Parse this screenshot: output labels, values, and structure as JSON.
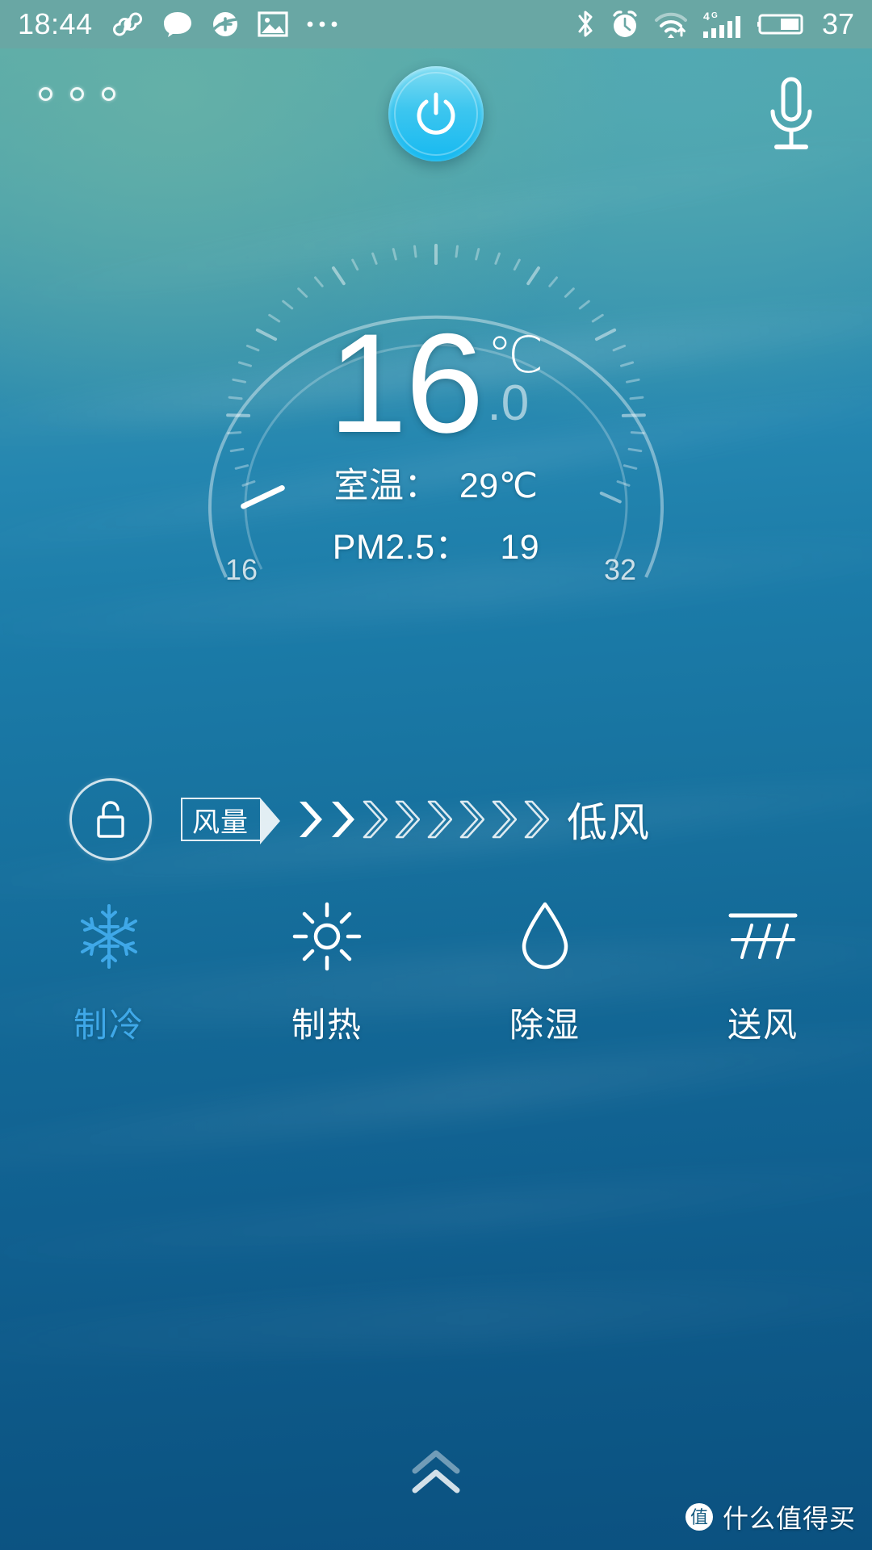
{
  "status_bar": {
    "time": "18:44",
    "battery_percent": "37",
    "network_type": "4G",
    "left_icons": [
      "infinity-icon",
      "chat-bubble-icon",
      "health-plus-icon",
      "gallery-icon",
      "more-dots-icon"
    ],
    "right_icons": [
      "bluetooth-icon",
      "alarm-clock-icon",
      "wifi-icon",
      "signal-bars-icon",
      "battery-icon"
    ],
    "background_color": "#69a7a4"
  },
  "top_bar": {
    "menu_dots_count": 3,
    "power_label": "power-toggle",
    "power_color": "#16b9f0",
    "mic_label": "voice-input"
  },
  "dial": {
    "set_temperature": "16",
    "temperature_decimal": ".0",
    "unit": "℃",
    "range_min": "16",
    "range_max": "32",
    "room_temp_line": "室温：  29℃",
    "pm25_line": "PM2.5：   19",
    "room_temp_label": "室温",
    "room_temp_value": "29℃",
    "pm25_label": "PM2.5",
    "pm25_value": "19",
    "tick_count": 41,
    "handle_position_value": "16"
  },
  "fan": {
    "lock_state": "unlocked",
    "tag_label": "风量",
    "level_total": 8,
    "level_active": 2,
    "state_label": "低风"
  },
  "modes": [
    {
      "label": "制冷",
      "icon": "snowflake-icon",
      "active": true,
      "color": "#3fa8e8"
    },
    {
      "label": "制热",
      "icon": "sun-icon",
      "active": false,
      "color": "#ffffff"
    },
    {
      "label": "除湿",
      "icon": "water-drop-icon",
      "active": false,
      "color": "#ffffff"
    },
    {
      "label": "送风",
      "icon": "air-flow-icon",
      "active": false,
      "color": "#ffffff"
    }
  ],
  "bottom": {
    "drawer_handle": "double-chevron-up-icon"
  },
  "watermark": {
    "logo_glyph": "值",
    "text": "什么值得买"
  }
}
